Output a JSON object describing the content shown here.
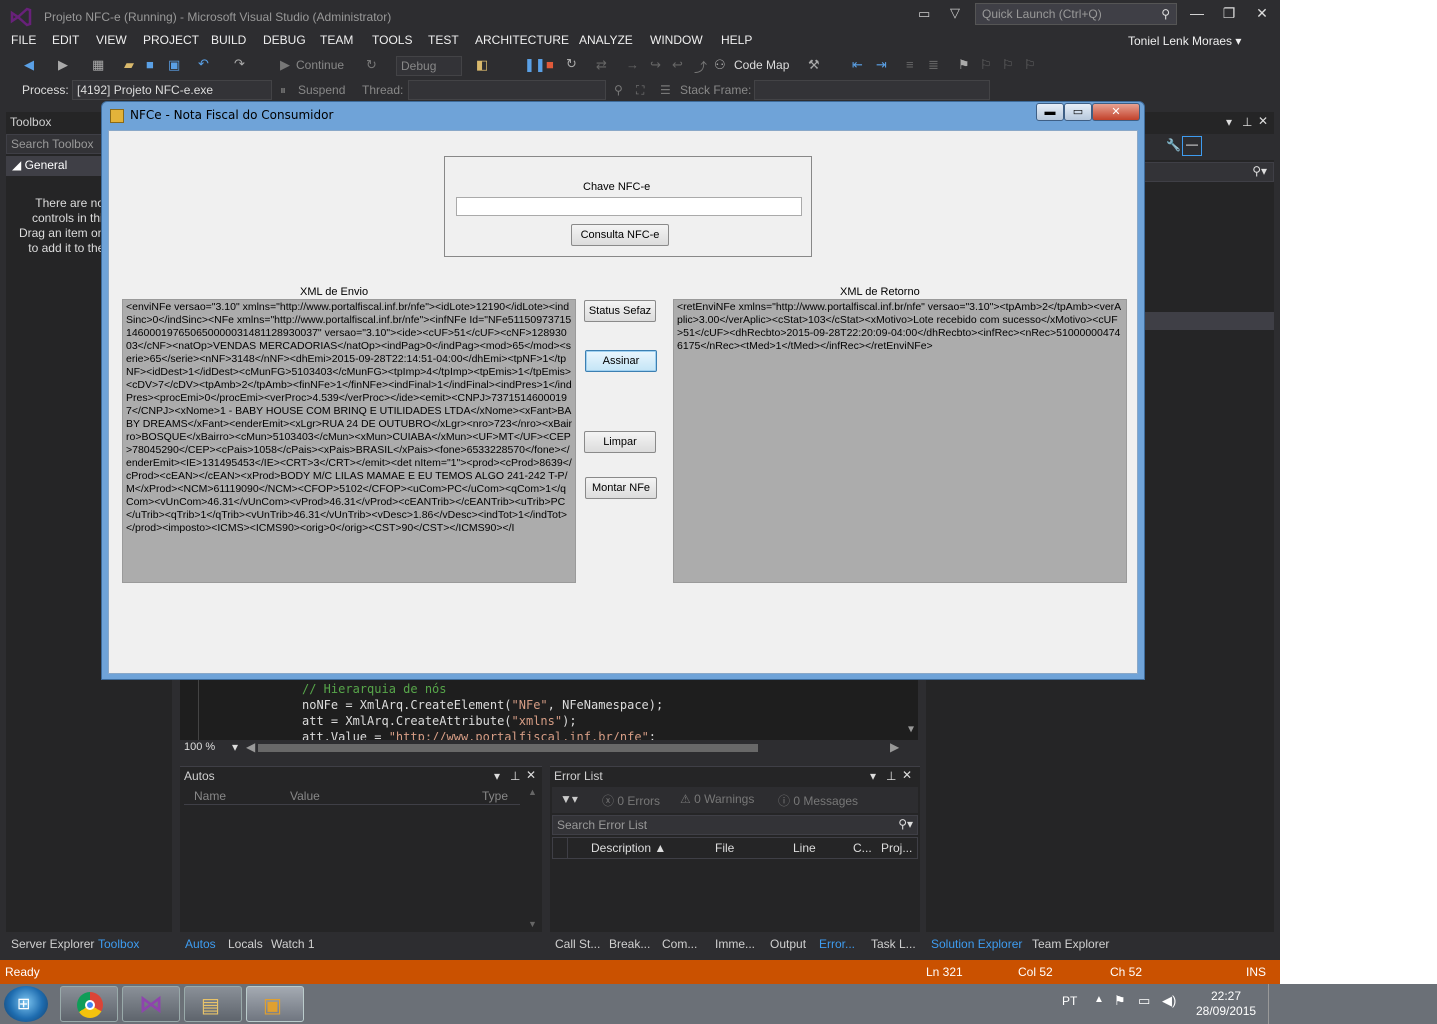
{
  "window": {
    "title": "Projeto NFC-e (Running) - Microsoft Visual Studio (Administrator)",
    "quick_launch_placeholder": "Quick Launch (Ctrl+Q)",
    "user": "Toniel Lenk Moraes"
  },
  "menu": [
    "FILE",
    "EDIT",
    "VIEW",
    "PROJECT",
    "BUILD",
    "DEBUG",
    "TEAM",
    "TOOLS",
    "TEST",
    "ARCHITECTURE",
    "ANALYZE",
    "WINDOW",
    "HELP"
  ],
  "toolbar": {
    "continue_label": "Continue",
    "config_value": "Debug",
    "code_map_label": "Code Map",
    "process_label": "Process:",
    "process_value": "[4192] Projeto NFC-e.exe",
    "suspend_label": "Suspend",
    "thread_label": "Thread:",
    "stack_frame_label": "Stack Frame:"
  },
  "toolbox": {
    "title": "Toolbox",
    "search_placeholder": "Search Toolbox",
    "section": "General",
    "empty_lines": [
      "There are no usable",
      "controls in this group.",
      "Drag an item onto this text",
      "to add it to the toolbox."
    ]
  },
  "editor": {
    "lines": [
      {
        "prefix": "",
        "comment": "// Hierarquia de nós",
        "suffix": ""
      },
      {
        "prefix": "noNFe = XmlArq.CreateElement(",
        "string": "\"NFe\"",
        "suffix": ", NFeNamespace);"
      },
      {
        "prefix": "att = XmlArq.CreateAttribute(",
        "string": "\"xmlns\"",
        "suffix": ");"
      },
      {
        "prefix": "att.Value = ",
        "string": "\"http://www.portalfiscal.inf.br/nfe\"",
        "suffix": ";"
      }
    ],
    "zoom": "100 %"
  },
  "autos": {
    "title": "Autos",
    "columns": [
      "Name",
      "Value",
      "Type"
    ],
    "tabs": [
      "Autos",
      "Locals",
      "Watch 1"
    ]
  },
  "error_list": {
    "title": "Error List",
    "errors": "0 Errors",
    "warnings": "0 Warnings",
    "messages": "0 Messages",
    "search_placeholder": "Search Error List",
    "columns": [
      "Description",
      "File",
      "Line",
      "C...",
      "Proj..."
    ],
    "tabs": [
      "Call St...",
      "Break...",
      "Com...",
      "Imme...",
      "Output",
      "Error...",
      "Task L..."
    ]
  },
  "left_tabs": [
    "Server Explorer",
    "Toolbox"
  ],
  "right_tabs": [
    "Solution Explorer",
    "Team Explorer"
  ],
  "status": {
    "ready": "Ready",
    "ln": "Ln 321",
    "col": "Col 52",
    "ch": "Ch 52",
    "mode": "INS"
  },
  "taskbar": {
    "lang": "PT",
    "time": "22:27",
    "date": "28/09/2015"
  },
  "dialog": {
    "title": "NFCe - Nota Fiscal do Consumidor",
    "chave_label": "Chave NFC-e",
    "chave_value": "",
    "consulta_button": "Consulta NFC-e",
    "envio_label": "XML de Envio",
    "retorno_label": "XML de Retorno",
    "status_button": "Status Sefaz",
    "assinar_button": "Assinar",
    "limpar_button": "Limpar",
    "montar_button": "Montar NFe",
    "envio_text": "<enviNFe versao=\"3.10\" xmlns=\"http://www.portalfiscal.inf.br/nfe\"><idLote>12190</idLote><indSinc>0</indSinc><NFe xmlns=\"http://www.portalfiscal.inf.br/nfe\"><infNFe Id=\"NFe51150973715146000197650650000031481128930037\" versao=\"3.10\"><ide><cUF>51</cUF><cNF>12893003</cNF><natOp>VENDAS MERCADORIAS</natOp><indPag>0</indPag><mod>65</mod><serie>65</serie><nNF>3148</nNF><dhEmi>2015-09-28T22:14:51-04:00</dhEmi><tpNF>1</tpNF><idDest>1</idDest><cMunFG>5103403</cMunFG><tpImp>4</tpImp><tpEmis>1</tpEmis><cDV>7</cDV><tpAmb>2</tpAmb><finNFe>1</finNFe><indFinal>1</indFinal><indPres>1</indPres><procEmi>0</procEmi><verProc>4.539</verProc></ide><emit><CNPJ>73715146000197</CNPJ><xNome>1 - BABY HOUSE COM BRINQ E UTILIDADES LTDA</xNome><xFant>BABY DREAMS</xFant><enderEmit><xLgr>RUA 24 DE OUTUBRO</xLgr><nro>723</nro><xBairro>BOSQUE</xBairro><cMun>5103403</cMun><xMun>CUIABA</xMun><UF>MT</UF><CEP>78045290</CEP><cPais>1058</cPais><xPais>BRASIL</xPais><fone>6533228570</fone></enderEmit><IE>131495453</IE><CRT>3</CRT></emit><det nItem=\"1\"><prod><cProd>8639</cProd><cEAN></cEAN><xProd>BODY M/C LILAS MAMAE E EU TEMOS ALGO 241-242 T-P/M</xProd><NCM>61119090</NCM><CFOP>5102</CFOP><uCom>PC</uCom><qCom>1</qCom><vUnCom>46.31</vUnCom><vProd>46.31</vProd><cEANTrib></cEANTrib><uTrib>PC</uTrib><qTrib>1</qTrib><vUnTrib>46.31</vUnTrib><vDesc>1.86</vDesc><indTot>1</indTot></prod><imposto><ICMS><ICMS90><orig>0</orig><CST>90</CST></ICMS90></I",
    "retorno_text": "<retEnviNFe xmlns=\"http://www.portalfiscal.inf.br/nfe\" versao=\"3.10\"><tpAmb>2</tpAmb><verAplic>3.00</verAplic><cStat>103</cStat><xMotivo>Lote recebido com sucesso</xMotivo><cUF>51</cUF><dhRecbto>2015-09-28T22:20:09-04:00</dhRecbto><infRec><nRec>510000004746175</nRec><tMed>1</tMed></infRec></retEnviNFe>"
  }
}
